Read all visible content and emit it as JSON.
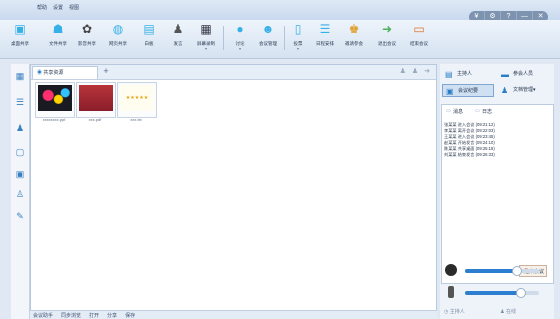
{
  "titlebar": {
    "menu": [
      "帮助",
      "设置",
      "视图"
    ],
    "window_buttons": [
      "¥",
      "⚙",
      "?",
      "—",
      "✕"
    ]
  },
  "toolbar": {
    "items": [
      {
        "label": "桌面共享",
        "icon": "screen-share-icon"
      },
      {
        "label": "文件共享",
        "icon": "file-share-icon"
      },
      {
        "label": "影音共享",
        "icon": "media-share-icon"
      },
      {
        "label": "网页共享",
        "icon": "web-share-icon"
      },
      {
        "label": "白板",
        "icon": "whiteboard-icon"
      },
      {
        "label": "发言",
        "icon": "speaker-icon"
      },
      {
        "label": "屏幕录制",
        "icon": "record-icon"
      },
      {
        "label": "讨论",
        "icon": "chat-icon"
      },
      {
        "label": "会议管理",
        "icon": "meeting-manage-icon"
      },
      {
        "label": "投票",
        "icon": "vote-icon"
      },
      {
        "label": "日程安排",
        "icon": "schedule-icon"
      },
      {
        "label": "邀请参会",
        "icon": "invite-icon"
      },
      {
        "label": "退出会议",
        "icon": "exit-icon"
      },
      {
        "label": "结束会议",
        "icon": "end-meeting-icon"
      }
    ]
  },
  "main": {
    "tab_label": "共享资源",
    "thumbnails": [
      {
        "caption": "",
        "label_below": "xxxxxxxx.ppt"
      },
      {
        "caption": "",
        "label_below": "xxx.pdf"
      },
      {
        "caption": "★★★★★",
        "label_below": "xxx.txt"
      }
    ]
  },
  "statusbar": {
    "items": [
      "会议助手",
      "同步浏览",
      "打开",
      "分享",
      "保存"
    ]
  },
  "right": {
    "buttons": [
      "主持人",
      "参会人员",
      "会议纪要",
      "文档管理"
    ],
    "subtabs": [
      "消息",
      "日志"
    ],
    "log_lines": [
      "张某某 进入会议 (09:21:12)",
      "李某某 离开会议 (09:22:03)",
      "王某某 进入会议 (09:23:45)",
      "赵某某 开始发言 (09:24:10)",
      "陈某某 共享桌面 (09:25:18)",
      "刘某某 结束发言 (09:26:33)"
    ],
    "end_button": "结束会议",
    "volume": {
      "speaker": 0.7,
      "mic": 0.75
    },
    "footer": [
      "主持人",
      "在线"
    ]
  }
}
